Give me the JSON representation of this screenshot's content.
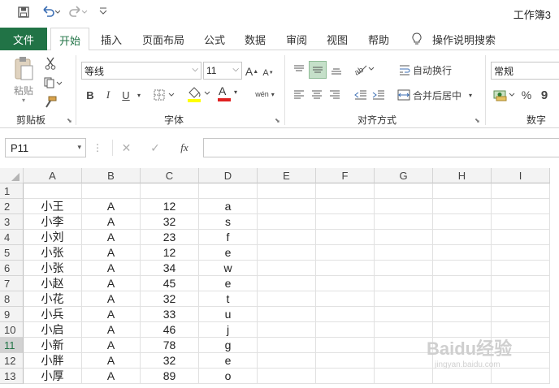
{
  "window": {
    "title": "工作簿3"
  },
  "tabs": [
    "文件",
    "开始",
    "插入",
    "页面布局",
    "公式",
    "数据",
    "审阅",
    "视图",
    "帮助",
    "操作说明搜索"
  ],
  "clipboard": {
    "paste_label": "粘贴",
    "group_label": "剪贴板"
  },
  "font": {
    "name": "等线",
    "size": "11",
    "group_label": "字体",
    "bold": "B",
    "italic": "I",
    "underline": "U",
    "grow": "A",
    "shrink": "A",
    "font_color_glyph": "A",
    "phonetic": "wén"
  },
  "alignment": {
    "wrap_label": "自动换行",
    "merge_label": "合并后居中",
    "group_label": "对齐方式"
  },
  "number": {
    "format": "常规",
    "percent": "%",
    "comma": "9",
    "group_label": "数字"
  },
  "formula_bar": {
    "name_box": "P11",
    "fx": "fx",
    "cancel": "✕",
    "enter": "✓"
  },
  "colors": {
    "brand": "#217346"
  },
  "columns": [
    "A",
    "B",
    "C",
    "D",
    "E",
    "F",
    "G",
    "H",
    "I"
  ],
  "rows": [
    {
      "n": "1",
      "cells": [
        "",
        "",
        "",
        ""
      ]
    },
    {
      "n": "2",
      "cells": [
        "小王",
        "A",
        "12",
        "a"
      ]
    },
    {
      "n": "3",
      "cells": [
        "小李",
        "A",
        "32",
        "s"
      ]
    },
    {
      "n": "4",
      "cells": [
        "小刘",
        "A",
        "23",
        "f"
      ]
    },
    {
      "n": "5",
      "cells": [
        "小张",
        "A",
        "12",
        "e"
      ]
    },
    {
      "n": "6",
      "cells": [
        "小张",
        "A",
        "34",
        "w"
      ]
    },
    {
      "n": "7",
      "cells": [
        "小赵",
        "A",
        "45",
        "e"
      ]
    },
    {
      "n": "8",
      "cells": [
        "小花",
        "A",
        "32",
        "t"
      ]
    },
    {
      "n": "9",
      "cells": [
        "小兵",
        "A",
        "33",
        "u"
      ]
    },
    {
      "n": "10",
      "cells": [
        "小启",
        "A",
        "46",
        "j"
      ]
    },
    {
      "n": "11",
      "cells": [
        "小新",
        "A",
        "78",
        "g"
      ]
    },
    {
      "n": "12",
      "cells": [
        "小胖",
        "A",
        "32",
        "e"
      ]
    },
    {
      "n": "13",
      "cells": [
        "小厚",
        "A",
        "89",
        "o"
      ]
    }
  ],
  "watermark": {
    "brand": "Baidu经验",
    "url": "jingyan.baidu.com"
  }
}
